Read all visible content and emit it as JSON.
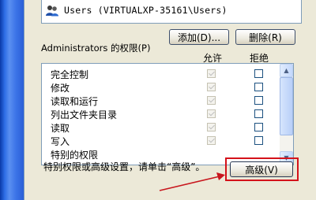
{
  "user_entry": {
    "text": "Users (VIRTUALXP-35161\\Users)",
    "icon": "users-group-icon"
  },
  "buttons": {
    "add": "添加(D)...",
    "remove": "删除(R)",
    "advanced": "高级(V)"
  },
  "permissions": {
    "title": "Administrators 的权限(P)",
    "allow_header": "允许",
    "deny_header": "拒绝",
    "rows": [
      {
        "name": "完全控制",
        "allow": true,
        "deny": false
      },
      {
        "name": "修改",
        "allow": true,
        "deny": false
      },
      {
        "name": "读取和运行",
        "allow": true,
        "deny": false
      },
      {
        "name": "列出文件夹目录",
        "allow": true,
        "deny": false
      },
      {
        "name": "读取",
        "allow": true,
        "deny": false
      },
      {
        "name": "写入",
        "allow": true,
        "deny": false
      },
      {
        "name": "特别的权限",
        "allow": false,
        "deny": false
      }
    ]
  },
  "hint": "特别权限或高级设置，请单击“高级”。",
  "colors": {
    "highlight": "#d4121a",
    "dialog_bg": "#ece9d8",
    "list_border": "#7f9db9"
  }
}
